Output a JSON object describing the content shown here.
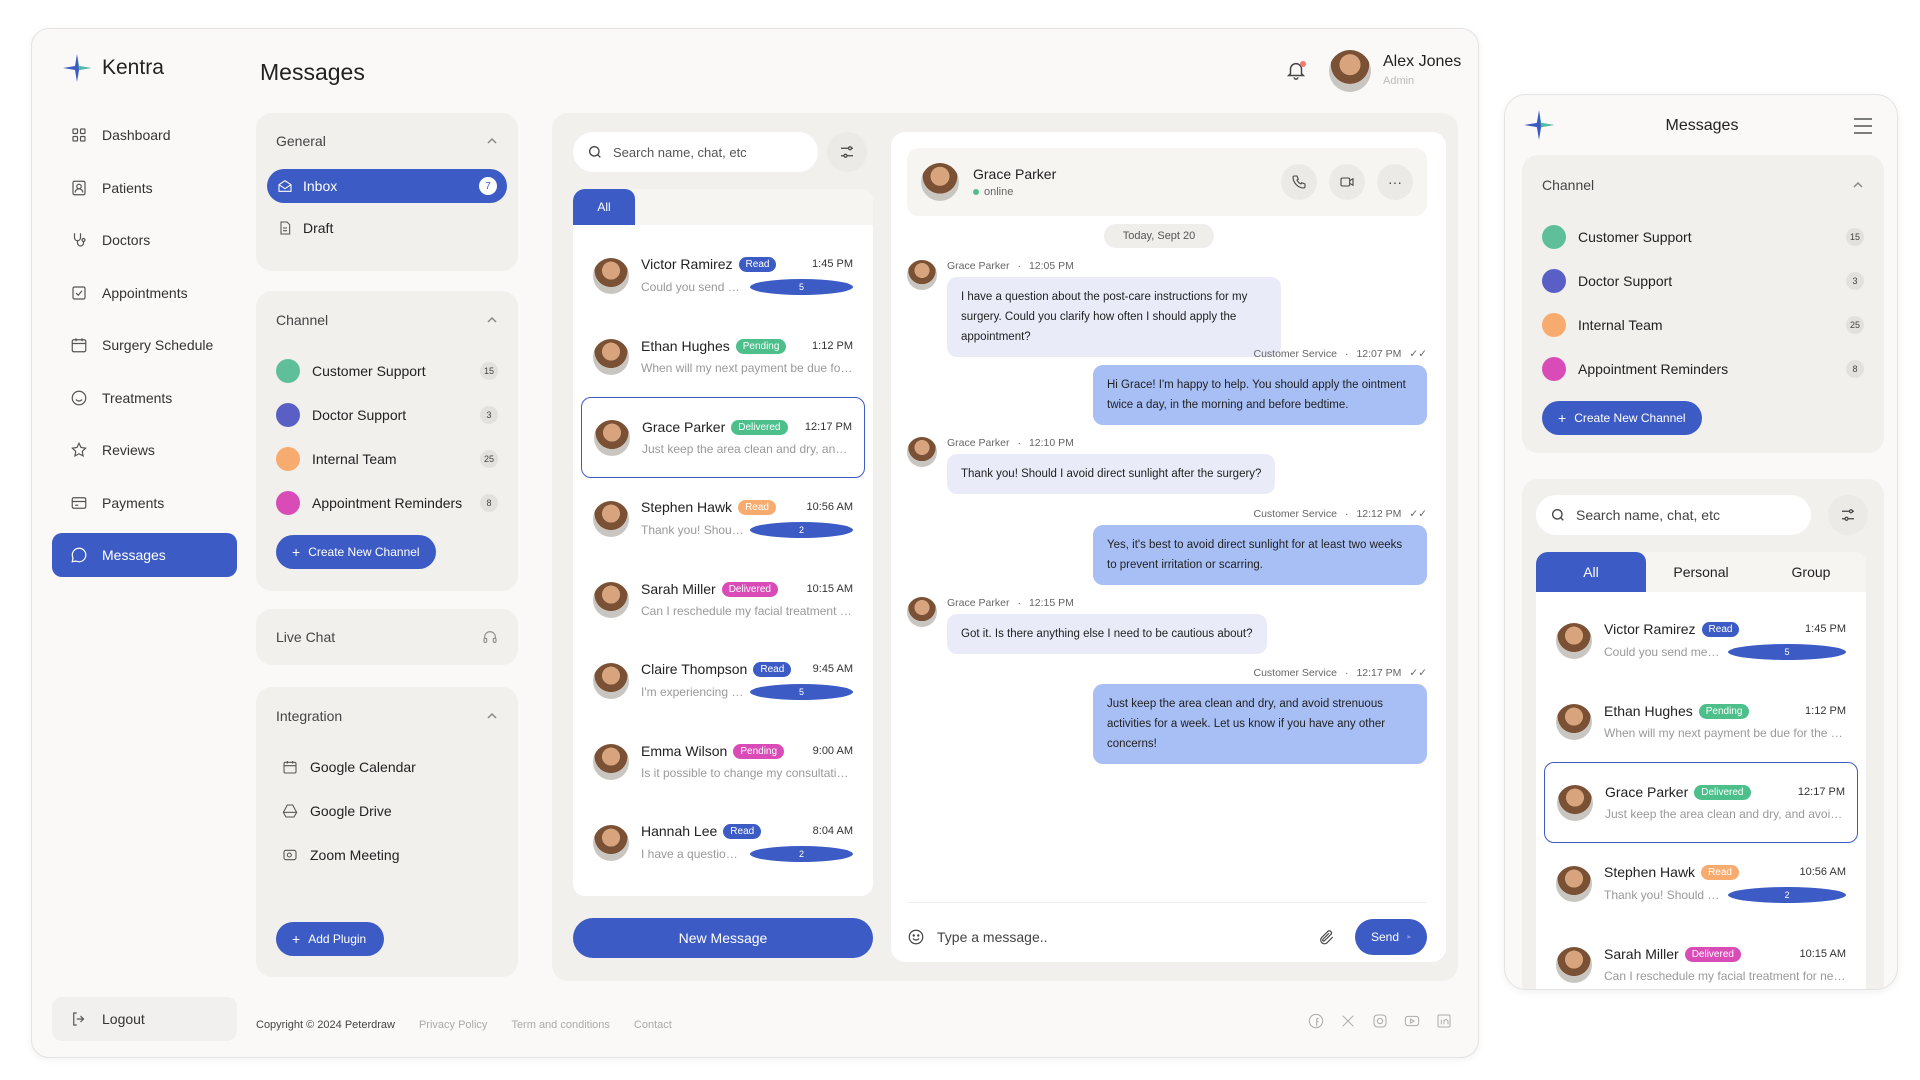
{
  "app": {
    "name": "Kentra",
    "page_title": "Messages"
  },
  "user": {
    "name": "Alex Jones",
    "role": "Admin"
  },
  "nav": [
    {
      "label": "Dashboard",
      "icon": "grid-icon"
    },
    {
      "label": "Patients",
      "icon": "patient-icon"
    },
    {
      "label": "Doctors",
      "icon": "stethoscope-icon"
    },
    {
      "label": "Appointments",
      "icon": "checkbox-icon"
    },
    {
      "label": "Surgery Schedule",
      "icon": "calendar-icon"
    },
    {
      "label": "Treatments",
      "icon": "smile-icon"
    },
    {
      "label": "Reviews",
      "icon": "star-icon"
    },
    {
      "label": "Payments",
      "icon": "card-icon"
    },
    {
      "label": "Messages",
      "icon": "chat-icon"
    }
  ],
  "logout": "Logout",
  "general": {
    "title": "General",
    "inbox": "Inbox",
    "inbox_count": "7",
    "draft": "Draft"
  },
  "channel": {
    "title": "Channel",
    "items": [
      {
        "label": "Customer Support",
        "count": "15",
        "color": "#5fbf9a"
      },
      {
        "label": "Doctor Support",
        "count": "3",
        "color": "#5a5fc6"
      },
      {
        "label": "Internal Team",
        "count": "25",
        "color": "#f8ab6f"
      },
      {
        "label": "Appointment Reminders",
        "count": "8",
        "color": "#d94cb8"
      }
    ],
    "create": "Create New Channel"
  },
  "live_chat": "Live Chat",
  "integration": {
    "title": "Integration",
    "items": [
      "Google Calendar",
      "Google Drive",
      "Zoom Meeting"
    ],
    "add": "Add Plugin"
  },
  "footer": {
    "copyright": "Copyright © 2024 Peterdraw",
    "privacy": "Privacy Policy",
    "terms": "Term and conditions",
    "contact": "Contact"
  },
  "search": {
    "placeholder": "Search name, chat, etc"
  },
  "tabs": [
    "All",
    "Personal",
    "Group"
  ],
  "status_colors": {
    "Read": "#3c5bc4",
    "Pending": "#4cbf8b",
    "Delivered": "#d94cb8"
  },
  "messages": [
    {
      "name": "Victor Ramirez",
      "status": "Read",
      "status_color": "#3c5bc4",
      "time": "1:45 PM",
      "preview": "Could you send me a copy of my invoice?",
      "unread": "5"
    },
    {
      "name": "Ethan Hughes",
      "status": "Pending",
      "status_color": "#4cbf8b",
      "time": "1:12 PM",
      "preview": "When will my next payment be due for the treatment?",
      "unread": ""
    },
    {
      "name": "Grace Parker",
      "status": "Delivered",
      "status_color": "#4cbf8b",
      "time": "12:17 PM",
      "preview": "Just keep the area clean and dry, and avoid strenuous activities",
      "unread": ""
    },
    {
      "name": "Stephen Hawk",
      "status": "Read",
      "status_color": "#f8ab6f",
      "time": "10:56 AM",
      "preview": "Thank you! Should I avoid direct sunlight?",
      "unread": "2"
    },
    {
      "name": "Sarah Miller",
      "status": "Delivered",
      "status_color": "#d94cb8",
      "time": "10:15 AM",
      "preview": "Can I reschedule my facial treatment for next week?",
      "unread": ""
    },
    {
      "name": "Claire Thompson",
      "status": "Read",
      "status_color": "#3c5bc4",
      "time": "9:45 AM",
      "preview": "I'm experiencing some swelling after the procedure",
      "unread": "5"
    },
    {
      "name": "Emma Wilson",
      "status": "Pending",
      "status_color": "#d94cb8",
      "time": "9:00 AM",
      "preview": "Is it possible to change my consultation date?",
      "unread": ""
    },
    {
      "name": "Hannah Lee",
      "status": "Read",
      "status_color": "#3c5bc4",
      "time": "8:04 AM",
      "preview": "I have a question about the post-care",
      "unread": "2"
    }
  ],
  "new_message": "New Message",
  "chat": {
    "name": "Grace Parker",
    "presence": "online",
    "date": "Today, Sept 20",
    "input_placeholder": "Type a message..",
    "send": "Send",
    "items": [
      {
        "dir": "in",
        "sender": "Grace Parker",
        "time": "12:05 PM",
        "text": "I have a question about the post-care instructions for my surgery. Could you clarify how often I should apply the appointment?"
      },
      {
        "dir": "out",
        "sender": "Customer Service",
        "time": "12:07 PM",
        "text": "Hi Grace! I'm happy to help. You should apply the ointment twice a day, in the morning and before bedtime."
      },
      {
        "dir": "in",
        "sender": "Grace Parker",
        "time": "12:10 PM",
        "text": "Thank you! Should I avoid direct sunlight after the surgery?"
      },
      {
        "dir": "out",
        "sender": "Customer Service",
        "time": "12:12 PM",
        "text": "Yes, it's best to avoid direct sunlight for at least two weeks to prevent irritation or scarring."
      },
      {
        "dir": "in",
        "sender": "Grace Parker",
        "time": "12:15 PM",
        "text": "Got it. Is there anything else I need to be cautious about?"
      },
      {
        "dir": "out",
        "sender": "Customer Service",
        "time": "12:17 PM",
        "text": "Just keep the area clean and dry, and avoid strenuous activities for a week. Let us know if you have any other concerns!"
      }
    ]
  },
  "mobile": {
    "title": "Messages",
    "channel_title": "Channel",
    "create": "Create New Channel"
  }
}
